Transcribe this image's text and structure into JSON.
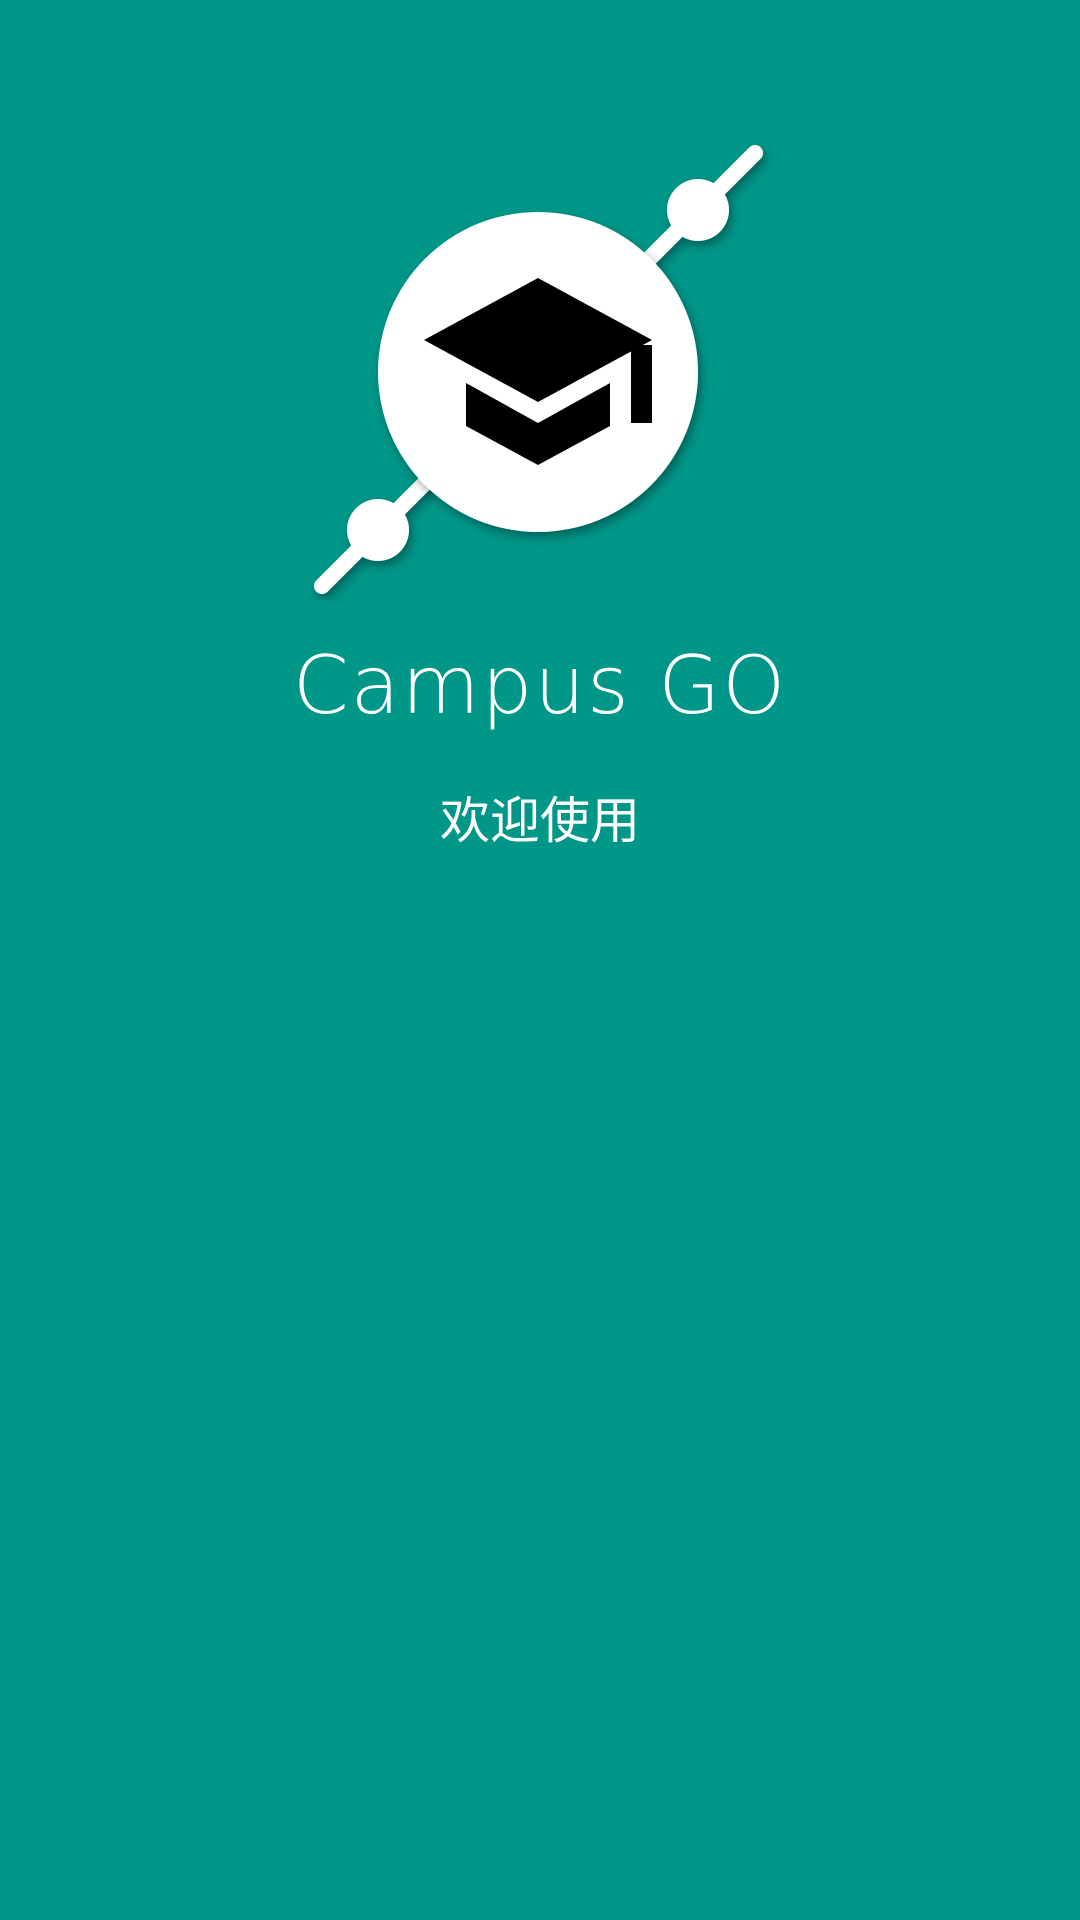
{
  "app": {
    "title": "Campus GO",
    "welcome": "欢迎使用"
  },
  "logo": {
    "icon": "graduation-cap-icon",
    "orbit": "orbit-ring-icon"
  },
  "colors": {
    "background": "#009688",
    "foreground": "#ffffff",
    "icon": "#000000"
  }
}
